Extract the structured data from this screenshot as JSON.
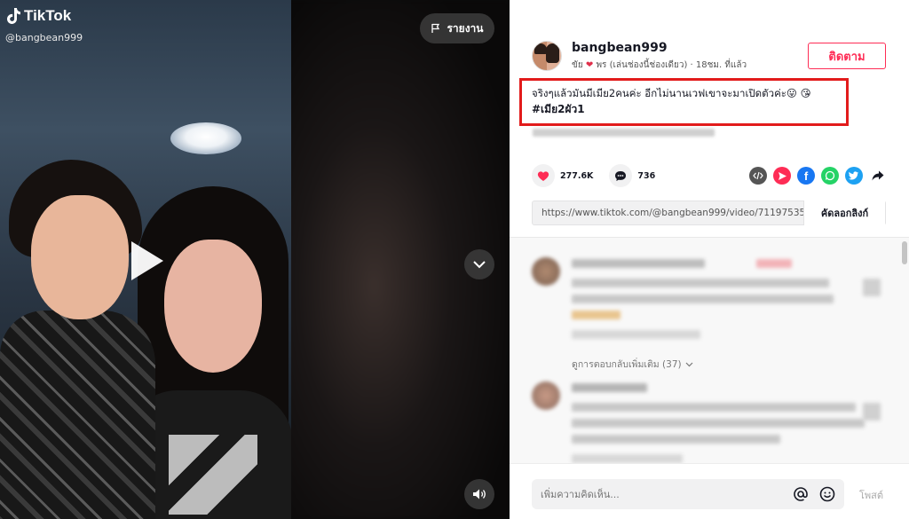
{
  "video": {
    "brand": "TikTok",
    "watermark_user": "@bangbean999",
    "report_label": "รายงาน"
  },
  "author": {
    "username": "bangbean999",
    "subtitle_prefix": "ขัย",
    "subtitle_suffix": "พร (เล่นช่องนี้ช่องเดียว) · 18ชม. ที่แล้ว",
    "follow_label": "ติดตาม"
  },
  "caption": {
    "text": "จริงๆแล้วมันมีเมีย2คนค่ะ อีกไม่นานเวฟเขาจะมาเปิดตัวค่ะ😛 😘",
    "hashtag": "#เมีย2ผัว1"
  },
  "stats": {
    "likes": "277.6K",
    "comments": "736"
  },
  "share": {
    "link": "https://www.tiktok.com/@bangbean999/video/71197535...",
    "copy_label": "คัดลอกลิงก์",
    "icons": [
      "embed-icon",
      "send-icon",
      "facebook-icon",
      "whatsapp-icon",
      "twitter-icon",
      "share-arrow-icon"
    ]
  },
  "comments_section": {
    "more_replies": "ดูการตอบกลับเพิ่มเติม (37)"
  },
  "composer": {
    "placeholder": "เพิ่มความคิดเห็น...",
    "post_label": "โพสต์"
  },
  "colors": {
    "accent": "#fe2c55",
    "highlight_box": "#e21b1b",
    "facebook": "#1877f2",
    "whatsapp": "#25d366",
    "twitter": "#1da1f2"
  }
}
